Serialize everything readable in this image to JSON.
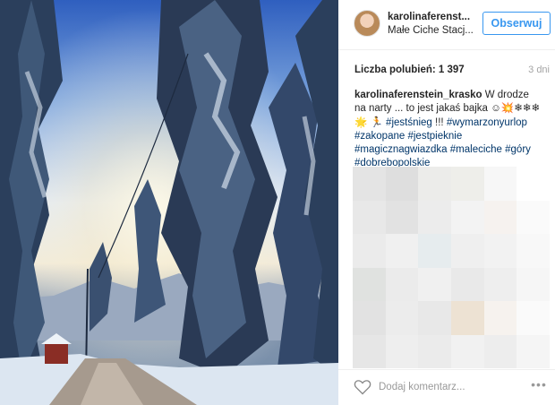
{
  "post": {
    "username": "karolinaferenst...",
    "location": "Małe Ciche Stacj...",
    "follow_label": "Obserwuj",
    "likes_label": "Liczba polubień: 1 397",
    "time_ago": "3 dni",
    "caption": {
      "user": "karolinaferenstein_krasko",
      "text": " W drodze na narty ... to jest jakaś bajka ☺",
      "emojis": "💥❄❄❄🌟 🏃",
      "tags": [
        "#jestśnieg",
        "#wymarzonyurlop",
        "#zakopane",
        "#jestpieknie",
        "#magicznagwiazdka",
        "#maleciche",
        "#góry",
        "#dobrebopolskie"
      ],
      "exclaim": " !!! "
    },
    "comment_placeholder": "Dodaj komentarz...",
    "more_label": "•••"
  },
  "colors": {
    "follow_blue": "#3897f0",
    "hashtag": "#003569",
    "muted": "#a5a5a5"
  },
  "icons": {
    "like": "heart-outline-icon",
    "more": "more-options-icon"
  }
}
